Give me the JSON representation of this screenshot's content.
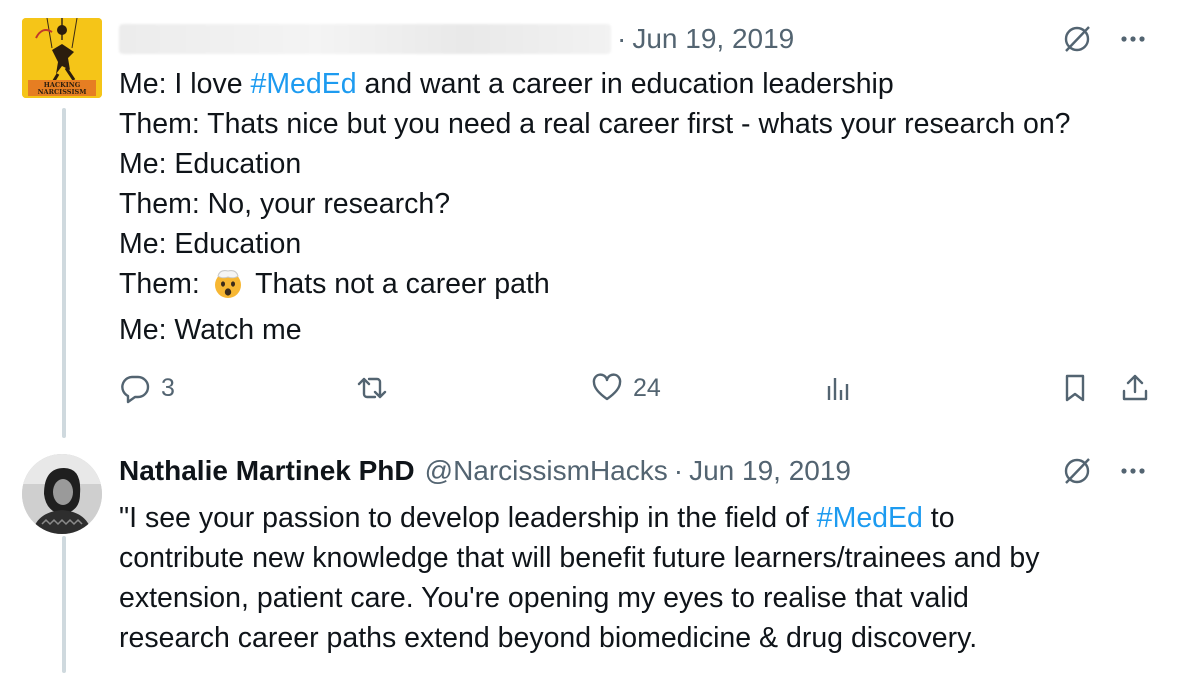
{
  "tweet1": {
    "date": "Jun 19, 2019",
    "lines": [
      {
        "prefix": "Me: I love ",
        "hashtag": "#MedEd",
        "suffix": " and want a career in education leadership"
      },
      {
        "text": "Them: Thats nice but you need a real career first - whats your research on?"
      },
      {
        "text": "Me: Education"
      },
      {
        "text": "Them: No, your research?"
      },
      {
        "text": "Me: Education"
      },
      {
        "prefix": "Them: ",
        "emoji": "exploding-head",
        "suffix": " Thats not a career path"
      },
      {
        "text": "Me: Watch me"
      }
    ],
    "avatar_text": [
      "HACKING",
      "NARCISSISM"
    ],
    "actions": {
      "replies": "3",
      "retweets": "",
      "likes": "24",
      "views": ""
    }
  },
  "tweet2": {
    "display_name": "Nathalie Martinek PhD",
    "handle": "@NarcissismHacks",
    "date": "Jun 19, 2019",
    "line1_prefix": "\"I see your passion to develop leadership in the field of ",
    "line1_hashtag": "#MedEd",
    "line1_suffix": " to",
    "line2": "contribute new knowledge that will benefit future learners/trainees and by",
    "line3": "extension, patient care. You're opening my eyes to realise that valid",
    "line4": "research career paths extend beyond biomedicine & drug discovery."
  },
  "colors": {
    "accent": "#1d9bf0",
    "muted": "#536471",
    "thread": "#cfd9de",
    "avatar_bg": "#f5c518"
  },
  "icons": {
    "grok": "no-sign-icon",
    "more": "more-icon",
    "reply": "reply-icon",
    "retweet": "retweet-icon",
    "like": "heart-icon",
    "views": "views-icon",
    "bookmark": "bookmark-icon",
    "share": "share-icon"
  }
}
